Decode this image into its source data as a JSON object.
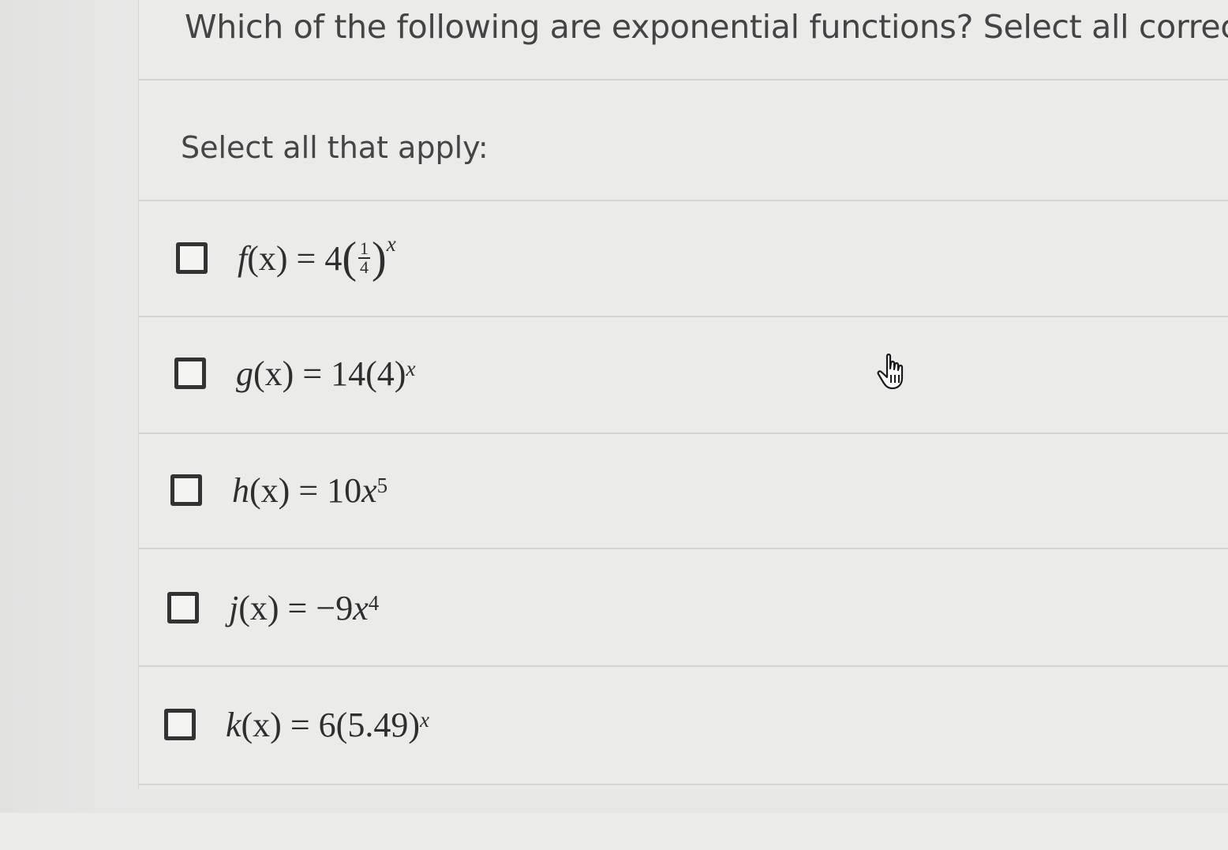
{
  "question": {
    "text": "Which of the following are exponential functions? Select all correct ar"
  },
  "instructions": "Select all that apply:",
  "options": [
    {
      "name": "f",
      "lhs": "f",
      "arg": "(x)",
      "eq": " = ",
      "coef": "4",
      "frac_num": "1",
      "frac_den": "4",
      "exp": "x",
      "checked": false
    },
    {
      "name": "g",
      "lhs": "g",
      "arg": "(x)",
      "eq": " = ",
      "body": "14(4)",
      "exp": "x",
      "checked": false
    },
    {
      "name": "h",
      "lhs": "h",
      "arg": "(x)",
      "eq": " = ",
      "body": "10",
      "var": "x",
      "exp": "5",
      "checked": false
    },
    {
      "name": "j",
      "lhs": "j",
      "arg": "(x)",
      "eq": " = ",
      "body": "−9",
      "var": "x",
      "exp": "4",
      "checked": false
    },
    {
      "name": "k",
      "lhs": "k",
      "arg": "(x)",
      "eq": " = ",
      "body": "6(5.49)",
      "exp": "x",
      "checked": false
    }
  ],
  "cursor_icon": "hand-pointer-icon"
}
